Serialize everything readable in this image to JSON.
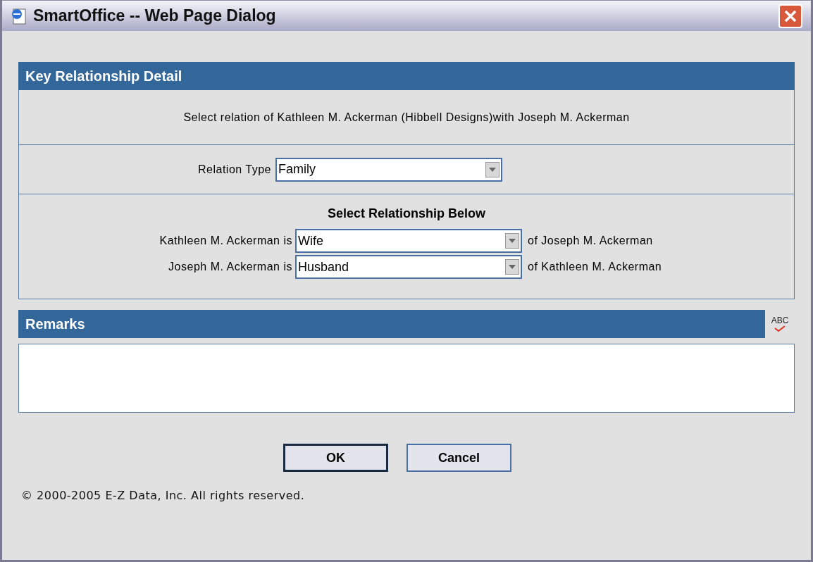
{
  "window": {
    "title": "SmartOffice -- Web Page Dialog"
  },
  "detail": {
    "title": "Key Relationship Detail",
    "prompt": "Select relation of Kathleen M. Ackerman (Hibbell Designs)with Joseph M. Ackerman",
    "relation_type": {
      "label": "Relation Type",
      "value": "Family"
    },
    "relationship": {
      "title": "Select Relationship Below",
      "rows": [
        {
          "label": "Kathleen M. Ackerman is",
          "value": "Wife",
          "suffix": "of Joseph M. Ackerman"
        },
        {
          "label": "Joseph M. Ackerman is",
          "value": "Husband",
          "suffix": "of Kathleen M. Ackerman"
        }
      ]
    }
  },
  "remarks": {
    "title": "Remarks",
    "spellcheck": "ABC"
  },
  "buttons": [
    {
      "label": "OK",
      "default": true
    },
    {
      "label": "Cancel",
      "default": false
    }
  ],
  "copyright": "© 2000-2005 E-Z Data, Inc. All rights reserved."
}
